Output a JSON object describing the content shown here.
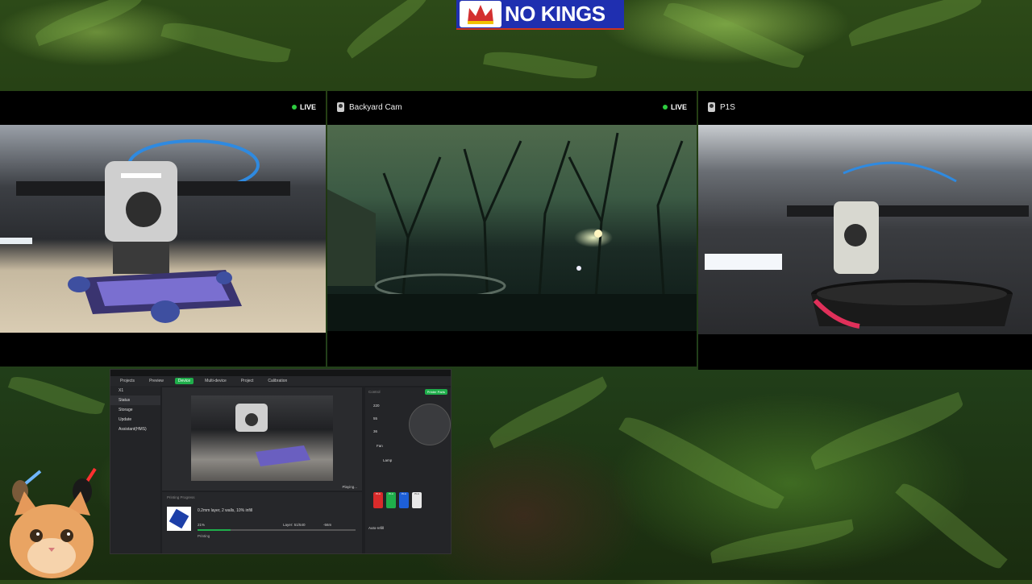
{
  "banner": {
    "text": "NO KINGS"
  },
  "cameras": [
    {
      "name": "",
      "live": "LIVE"
    },
    {
      "name": "Backyard Cam",
      "live": "LIVE"
    },
    {
      "name": "P1S",
      "live": ""
    }
  ],
  "app": {
    "nav": [
      "Projects",
      "Preview",
      "Device",
      "Multi-device",
      "Project",
      "Calibration"
    ],
    "active_nav": "Device",
    "side_header": "X1",
    "side": [
      "Status",
      "Storage",
      "Update",
      "Assistant(HMS)"
    ],
    "video_status": "Playing...",
    "print_label": "Printing Progress",
    "print_desc": "0.2mm layer, 2 walls, 10% infill",
    "progress_pct": 21,
    "progress_text": "21%",
    "layer_text": "Layer: 51/540",
    "remaining_text": "-56m",
    "printing_label": "Printing",
    "control_label": "Control",
    "printer_parts_btn": "Printer Parts",
    "temps": [
      "220",
      "55",
      "36"
    ],
    "fan_label": "Fan",
    "lamp_label": "Lamp",
    "auto_refill": "Auto-refill",
    "slots": [
      {
        "label": "PLA",
        "color": "#d92b2b"
      },
      {
        "label": "PLA",
        "color": "#1fae4b"
      },
      {
        "label": "PLA",
        "color": "#1d5fd8"
      },
      {
        "label": "PLA",
        "color": "#e8e8e8"
      }
    ]
  },
  "colors": {
    "accent": "#1fae4b",
    "live_dot": "#2ecc40",
    "banner_bg": "#1f2fb0"
  }
}
